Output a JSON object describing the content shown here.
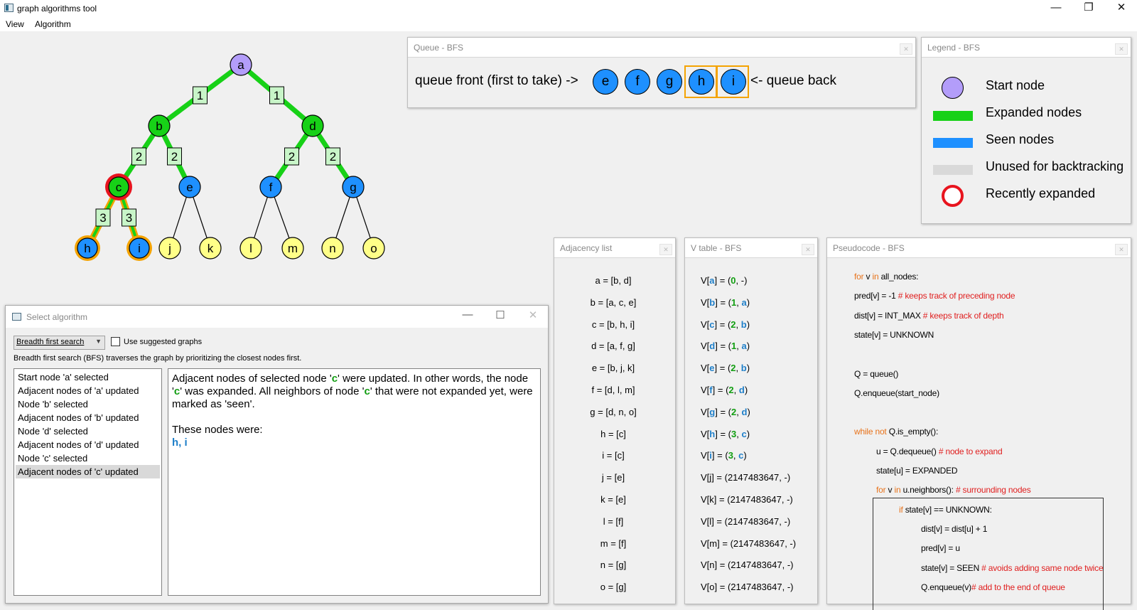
{
  "app": {
    "title": "graph algorithms tool"
  },
  "menu": {
    "view": "View",
    "algorithm": "Algorithm"
  },
  "window_controls": {
    "minimize": "—",
    "maximize": "❐",
    "close": "✕"
  },
  "graph": {
    "nodes": [
      {
        "id": "a",
        "state": "start"
      },
      {
        "id": "b",
        "state": "expanded"
      },
      {
        "id": "d",
        "state": "expanded"
      },
      {
        "id": "c",
        "state": "recently-expanded"
      },
      {
        "id": "e",
        "state": "seen"
      },
      {
        "id": "f",
        "state": "seen"
      },
      {
        "id": "g",
        "state": "seen"
      },
      {
        "id": "h",
        "state": "seen",
        "queued": true
      },
      {
        "id": "i",
        "state": "seen",
        "queued": true
      },
      {
        "id": "j",
        "state": "unknown"
      },
      {
        "id": "k",
        "state": "unknown"
      },
      {
        "id": "l",
        "state": "unknown"
      },
      {
        "id": "m",
        "state": "unknown"
      },
      {
        "id": "n",
        "state": "unknown"
      },
      {
        "id": "o",
        "state": "unknown"
      }
    ],
    "edges": [
      {
        "from": "a",
        "to": "b",
        "label": "1",
        "style": "expanded"
      },
      {
        "from": "a",
        "to": "d",
        "label": "1",
        "style": "expanded"
      },
      {
        "from": "b",
        "to": "c",
        "label": "2",
        "style": "expanded"
      },
      {
        "from": "b",
        "to": "e",
        "label": "2",
        "style": "expanded"
      },
      {
        "from": "d",
        "to": "f",
        "label": "2",
        "style": "expanded"
      },
      {
        "from": "d",
        "to": "g",
        "label": "2",
        "style": "expanded"
      },
      {
        "from": "c",
        "to": "h",
        "label": "3",
        "style": "recent"
      },
      {
        "from": "c",
        "to": "i",
        "label": "3",
        "style": "recent"
      },
      {
        "from": "e",
        "to": "j",
        "style": "plain"
      },
      {
        "from": "e",
        "to": "k",
        "style": "plain"
      },
      {
        "from": "f",
        "to": "l",
        "style": "plain"
      },
      {
        "from": "f",
        "to": "m",
        "style": "plain"
      },
      {
        "from": "g",
        "to": "n",
        "style": "plain"
      },
      {
        "from": "g",
        "to": "o",
        "style": "plain"
      }
    ],
    "colors": {
      "start": "#b39dfa",
      "expanded": "#17d117",
      "seen": "#1e90ff",
      "unknown": "#ffff88",
      "recent_ring": "#e8141e",
      "queued_ring": "#f4a300",
      "edge_label_bg": "#c8f5c8"
    }
  },
  "queue_panel": {
    "title": "Queue - BFS",
    "front_label": "queue front (first to take) ->",
    "back_label": "<- queue back",
    "items": [
      "e",
      "f",
      "g",
      "h",
      "i"
    ]
  },
  "legend_panel": {
    "title": "Legend - BFS",
    "items": [
      "Start node",
      "Expanded nodes",
      "Seen nodes",
      "Unused for backtracking",
      "Recently expanded"
    ],
    "colors": [
      "#b39dfa",
      "#17d117",
      "#1e90ff",
      "#d9d9d9",
      "#e8141e"
    ]
  },
  "adjacency_panel": {
    "title": "Adjacency list",
    "lines": [
      "a = [b, d]",
      "b = [a, c, e]",
      "c = [b, h, i]",
      "d = [a, f, g]",
      "e = [b, j, k]",
      "f = [d, l, m]",
      "g = [d, n, o]",
      "h = [c]",
      "i = [c]",
      "j = [e]",
      "k = [e]",
      "l = [f]",
      "m = [f]",
      "n = [g]",
      "o = [g]"
    ]
  },
  "vtable_panel": {
    "title": "V table - BFS",
    "rows": [
      {
        "node": "a",
        "dist": "0",
        "pred": "-",
        "set": true
      },
      {
        "node": "b",
        "dist": "1",
        "pred": "a",
        "set": true
      },
      {
        "node": "c",
        "dist": "2",
        "pred": "b",
        "set": true
      },
      {
        "node": "d",
        "dist": "1",
        "pred": "a",
        "set": true
      },
      {
        "node": "e",
        "dist": "2",
        "pred": "b",
        "set": true
      },
      {
        "node": "f",
        "dist": "2",
        "pred": "d",
        "set": true
      },
      {
        "node": "g",
        "dist": "2",
        "pred": "d",
        "set": true
      },
      {
        "node": "h",
        "dist": "3",
        "pred": "c",
        "set": true
      },
      {
        "node": "i",
        "dist": "3",
        "pred": "c",
        "set": true
      },
      {
        "node": "j",
        "dist": "2147483647",
        "pred": "-",
        "set": false
      },
      {
        "node": "k",
        "dist": "2147483647",
        "pred": "-",
        "set": false
      },
      {
        "node": "l",
        "dist": "2147483647",
        "pred": "-",
        "set": false
      },
      {
        "node": "m",
        "dist": "2147483647",
        "pred": "-",
        "set": false
      },
      {
        "node": "n",
        "dist": "2147483647",
        "pred": "-",
        "set": false
      },
      {
        "node": "o",
        "dist": "2147483647",
        "pred": "-",
        "set": false
      }
    ]
  },
  "pseudocode_panel": {
    "title": "Pseudocode - BFS",
    "lines": [
      {
        "indent": 0,
        "parts": [
          {
            "t": "for",
            "c": "kw"
          },
          {
            "t": " v "
          },
          {
            "t": "in",
            "c": "kw"
          },
          {
            "t": " all_nodes:"
          }
        ]
      },
      {
        "indent": 0,
        "parts": [
          {
            "t": "pred[v] = -1 "
          },
          {
            "t": "# keeps track of preceding node",
            "c": "cm"
          }
        ]
      },
      {
        "indent": 0,
        "parts": [
          {
            "t": "dist[v] = INT_MAX "
          },
          {
            "t": "# keeps track of depth",
            "c": "cm"
          }
        ]
      },
      {
        "indent": 0,
        "parts": [
          {
            "t": "state[v] = UNKNOWN"
          }
        ]
      },
      {
        "indent": 0,
        "parts": []
      },
      {
        "indent": 0,
        "parts": [
          {
            "t": "Q = queue()"
          }
        ]
      },
      {
        "indent": 0,
        "parts": [
          {
            "t": "Q.enqueue(start_node)"
          }
        ]
      },
      {
        "indent": 0,
        "parts": []
      },
      {
        "indent": 0,
        "parts": [
          {
            "t": "while not",
            "c": "kw"
          },
          {
            "t": " Q.is_empty():"
          }
        ]
      },
      {
        "indent": 1,
        "parts": [
          {
            "t": "u = Q.dequeue() "
          },
          {
            "t": "# node to expand",
            "c": "cm"
          }
        ]
      },
      {
        "indent": 1,
        "parts": [
          {
            "t": "state[u] = EXPANDED"
          }
        ]
      },
      {
        "indent": 1,
        "parts": [
          {
            "t": "for",
            "c": "kw"
          },
          {
            "t": " v "
          },
          {
            "t": "in",
            "c": "kw"
          },
          {
            "t": " u.neighbors(): "
          },
          {
            "t": "# surrounding nodes",
            "c": "cm"
          }
        ]
      },
      {
        "indent": 2,
        "parts": [
          {
            "t": "if",
            "c": "kw"
          },
          {
            "t": " state[v] == UNKNOWN:"
          }
        ]
      },
      {
        "indent": 3,
        "parts": [
          {
            "t": "dist[v] = dist[u] + 1"
          }
        ]
      },
      {
        "indent": 3,
        "parts": [
          {
            "t": "pred[v] = u"
          }
        ]
      },
      {
        "indent": 3,
        "parts": [
          {
            "t": "state[v] = SEEN "
          },
          {
            "t": "# avoids adding same node twice",
            "c": "cm"
          }
        ]
      },
      {
        "indent": 3,
        "parts": [
          {
            "t": "Q.enqueue(v)"
          },
          {
            "t": "# add to the end of queue",
            "c": "cm"
          }
        ]
      }
    ]
  },
  "select_window": {
    "title": "Select algorithm",
    "combo_value": "Breadth first search",
    "checkbox_label": "Use suggested graphs",
    "description": "Breadth first search (BFS) traverses the graph by prioritizing the closest nodes first.",
    "steps": [
      "Start node 'a' selected",
      "Adjacent nodes of 'a' updated",
      "Node 'b' selected",
      "Adjacent nodes of 'b' updated",
      "Node 'd' selected",
      "Adjacent nodes of 'd' updated",
      "Node 'c' selected",
      "Adjacent nodes of 'c' updated"
    ],
    "selected_step": 7,
    "detail": {
      "p1": "Adjacent nodes of selected node '",
      "p1_node": "c",
      "p2": "' were updated. In other words, the node '",
      "p2_node": "c",
      "p3": "' was expanded. All neighbors of node '",
      "p3_node": "c",
      "p4": "' that were not expanded yet, were marked as 'seen'.",
      "p5": "These nodes were:",
      "nodes": "h, i"
    }
  }
}
